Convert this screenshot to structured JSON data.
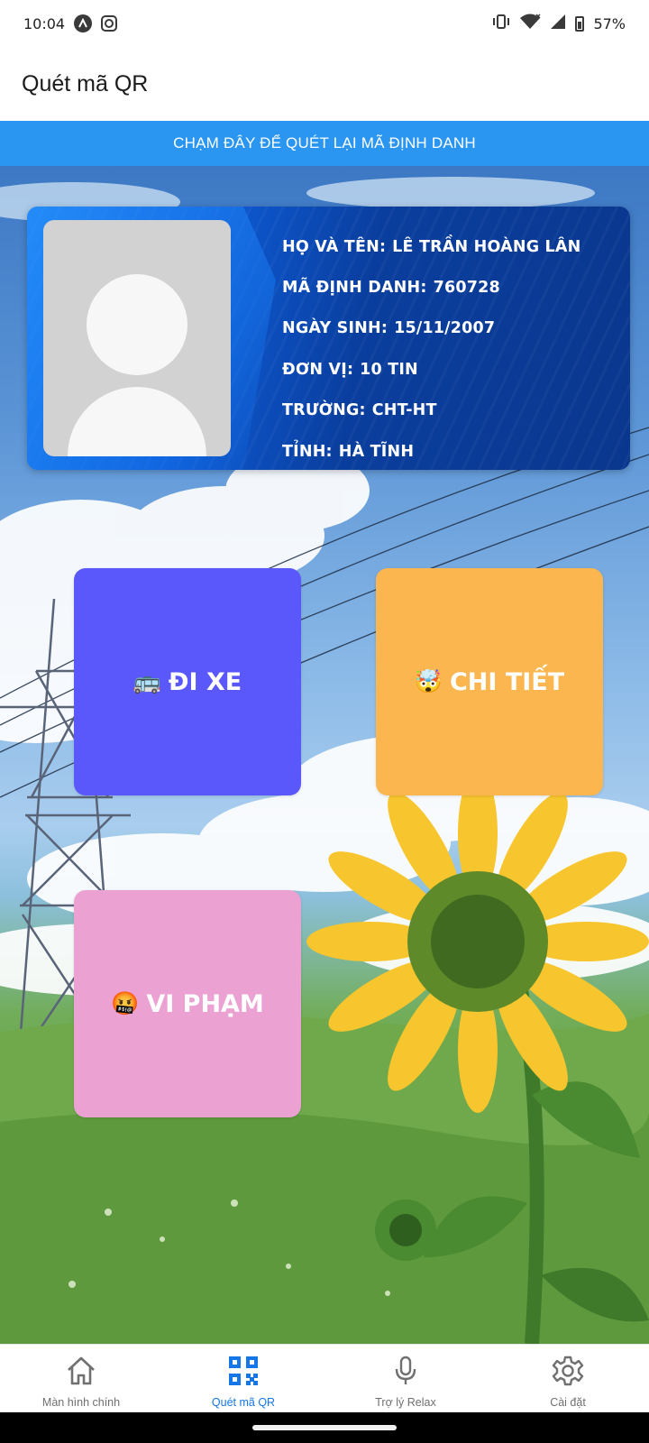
{
  "status_bar": {
    "time": "10:04",
    "battery": "57%",
    "icons": [
      "app-circle-icon",
      "instagram-icon",
      "vibrate-icon",
      "wifi-icon",
      "signal-icon",
      "battery-icon"
    ]
  },
  "app_bar": {
    "title": "Quét mã QR"
  },
  "banner": {
    "label": "CHẠM ĐÂY ĐỂ QUÉT LẠI MÃ ĐỊNH DANH",
    "color": "#2a96f2"
  },
  "card": {
    "fields": [
      {
        "label": "Họ và tên",
        "value": "Lê Trần Hoàng Lân"
      },
      {
        "label": "Mã định danh",
        "value": "760728"
      },
      {
        "label": "Ngày sinh",
        "value": "15/11/2007"
      },
      {
        "label": "Đơn vị",
        "value": "10 TIN"
      },
      {
        "label": "Trường",
        "value": "CHT-HT"
      },
      {
        "label": "Tỉnh",
        "value": "Hà Tĩnh"
      }
    ]
  },
  "tiles": {
    "ride": {
      "emoji": "🚌",
      "label": "Đi xe",
      "color": "#5a57fb"
    },
    "detail": {
      "emoji": "🤯",
      "label": "Chi tiết",
      "color": "#fcb64f"
    },
    "violation": {
      "emoji": "🤬",
      "label": "Vi phạm",
      "color": "#eba2d3"
    }
  },
  "bottom_nav": {
    "active_color": "#1576e8",
    "items": [
      {
        "label": "Màn hình chính",
        "icon": "home-icon"
      },
      {
        "label": "Quét mã QR",
        "icon": "qr-code-icon"
      },
      {
        "label": "Trợ lý Relax",
        "icon": "microphone-icon"
      },
      {
        "label": "Cài đặt",
        "icon": "settings-gear-icon"
      }
    ]
  }
}
